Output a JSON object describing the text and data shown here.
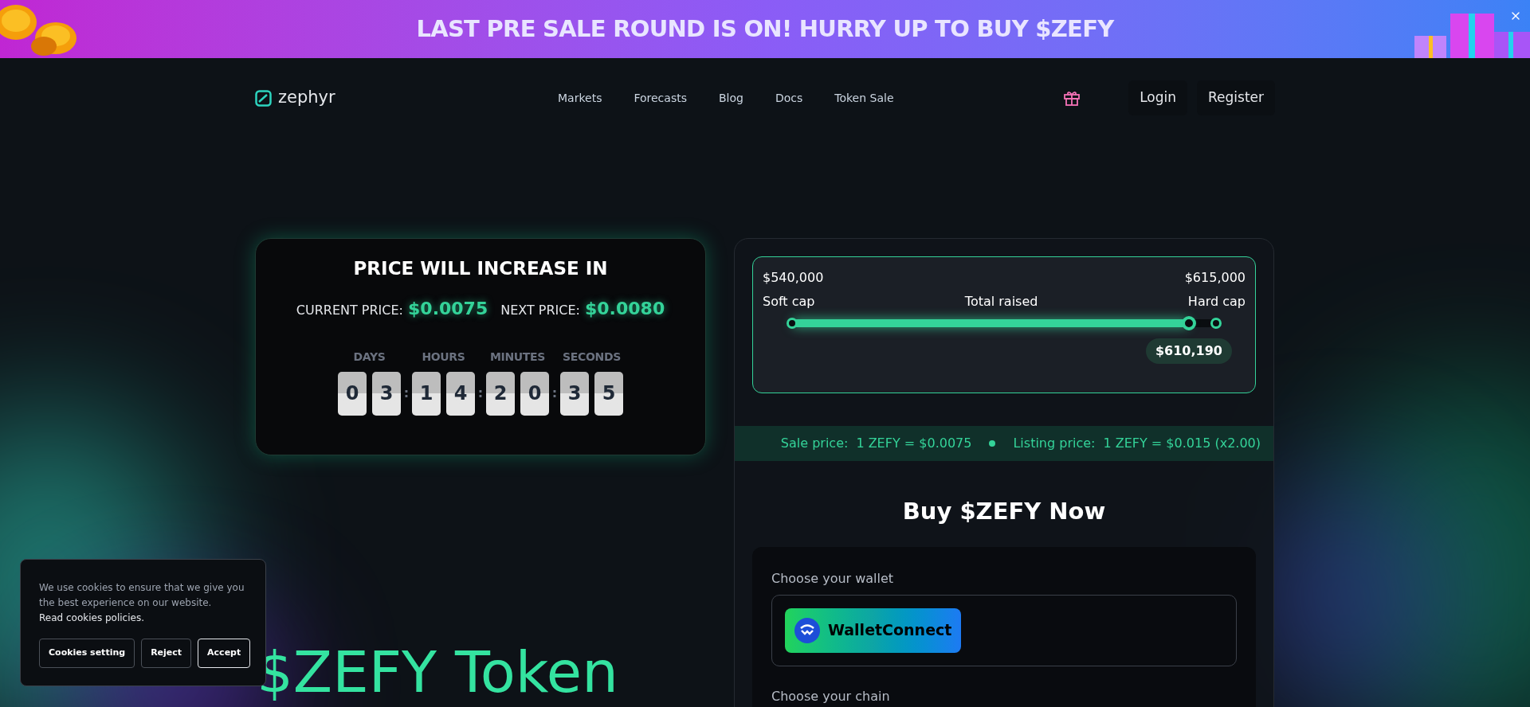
{
  "banner": {
    "text": "LAST PRE SALE ROUND IS ON! HURRY UP TO BUY $ZEFY"
  },
  "nav": {
    "logo": "zephyr",
    "links": [
      "Markets",
      "Forecasts",
      "Blog",
      "Docs",
      "Token Sale"
    ],
    "login": "Login",
    "register": "Register"
  },
  "countdown": {
    "title": "PRICE WILL INCREASE IN",
    "current_label": "CURRENT PRICE:",
    "current_price": "$0.0075",
    "next_label": "NEXT PRICE:",
    "next_price": "$0.0080",
    "separator": ":",
    "units": [
      {
        "label": "DAYS",
        "digits": [
          "0",
          "3"
        ]
      },
      {
        "label": "HOURS",
        "digits": [
          "1",
          "4"
        ]
      },
      {
        "label": "MINUTES",
        "digits": [
          "2",
          "0"
        ]
      },
      {
        "label": "SECONDS",
        "digits": [
          "3",
          "5"
        ]
      }
    ]
  },
  "progress": {
    "soft_value": "$540,000",
    "soft_label": "Soft cap",
    "middle_label": "Total raised",
    "hard_value": "$615,000",
    "hard_label": "Hard cap",
    "level": 0.936,
    "raised": "$610,190"
  },
  "prices": {
    "sale_label": "Sale price:",
    "sale_value": "1 ZEFY = $0.0075",
    "listing_label": "Listing price:",
    "listing_value": "1 ZEFY = $0.015 (x2.00)"
  },
  "buy": {
    "title": "Buy $ZEFY Now",
    "wallet_label": "Choose your wallet",
    "wallet_button": "WalletConnect",
    "chain_label": "Choose your chain"
  },
  "hero": {
    "title": "$ZEFY Token"
  },
  "cookies": {
    "text": "We use cookies to ensure that we give you the best experience on our website.",
    "link": "Read cookies policies.",
    "buttons": [
      "Cookies setting",
      "Reject",
      "Accept"
    ]
  }
}
